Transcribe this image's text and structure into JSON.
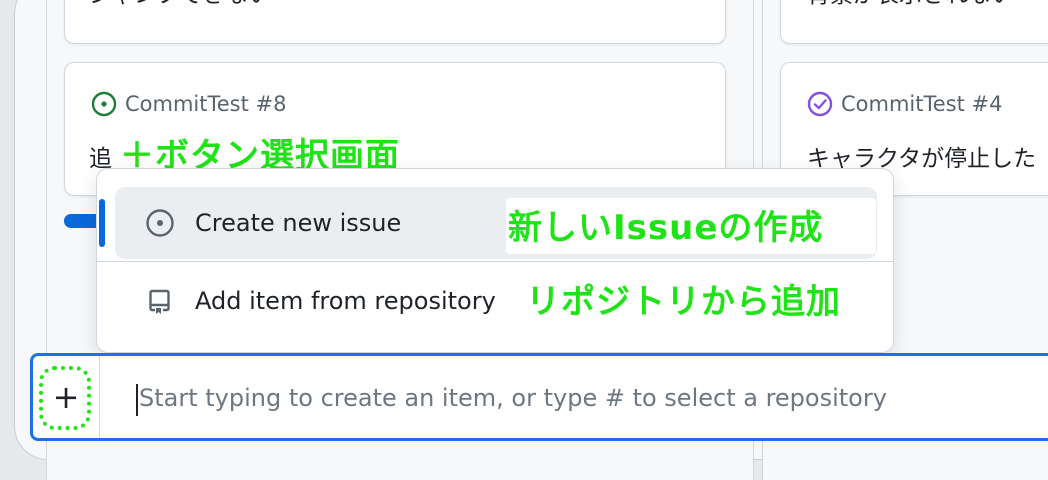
{
  "board": {
    "top_cards": [
      {
        "title": "ジャンプできない"
      },
      {
        "title": "背景が表示されない"
      }
    ],
    "cards": [
      {
        "meta": "CommitTest #8",
        "title": "追",
        "status": "open",
        "status_color": "#1a7f37"
      },
      {
        "meta": "CommitTest #4",
        "title": "キャラクタが停止した",
        "status": "closed",
        "status_color": "#8250df"
      }
    ]
  },
  "add_menu": {
    "items": [
      {
        "label": "Create new issue",
        "icon": "issue-opened-icon"
      },
      {
        "label": "Add item from repository",
        "icon": "repo-icon"
      }
    ]
  },
  "composer": {
    "plus_label": "+",
    "placeholder": "Start typing to create an item, or type # to select a repository"
  },
  "annotations": {
    "plus_menu": "＋ボタン選択画面",
    "new_issue": "新しいIssueの作成",
    "from_repo": "リポジトリから追加",
    "color": "#1fe316"
  },
  "colors": {
    "accent": "#1f6feb",
    "open": "#1a7f37",
    "closed": "#8250df"
  }
}
